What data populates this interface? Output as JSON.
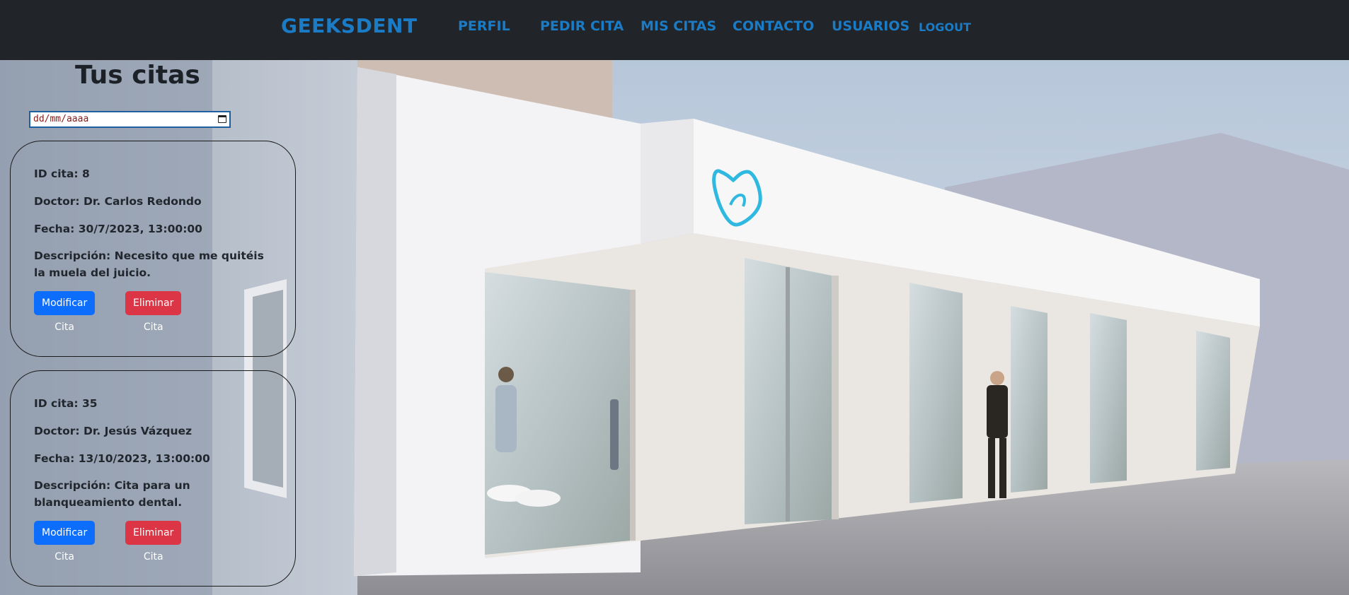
{
  "nav": {
    "brand": "GEEKSDENT",
    "links": [
      "PERFIL",
      "PEDIR CITA",
      "MIS CITAS",
      "CONTACTO",
      "USUARIOS",
      "LOGOUT"
    ]
  },
  "page": {
    "title": "Tus citas",
    "date_filter": {
      "placeholder": "dd/mm/aaaa"
    }
  },
  "appointments": [
    {
      "id": "ID cita: 8",
      "doctor": "Doctor: Dr. Carlos Redondo",
      "date": "Fecha: 30/7/2023, 13:00:00",
      "description": "Descripción: Necesito que me quitéis la muela del juicio.",
      "edit_label": "Modificar Cita",
      "delete_label": "Eliminar Cita"
    },
    {
      "id": "ID cita: 35",
      "doctor": "Doctor: Dr. Jesús Vázquez",
      "date": "Fecha: 13/10/2023, 13:00:00",
      "description": "Descripción: Cita para un blanqueamiento dental.",
      "edit_label": "Modificar Cita",
      "delete_label": "Eliminar Cita"
    }
  ],
  "colors": {
    "navbar_bg": "#212529",
    "nav_link": "#1a7bc6",
    "btn_primary": "#0d6efd",
    "btn_danger": "#dc3545",
    "logo_tooth": "#2fb8e0"
  }
}
